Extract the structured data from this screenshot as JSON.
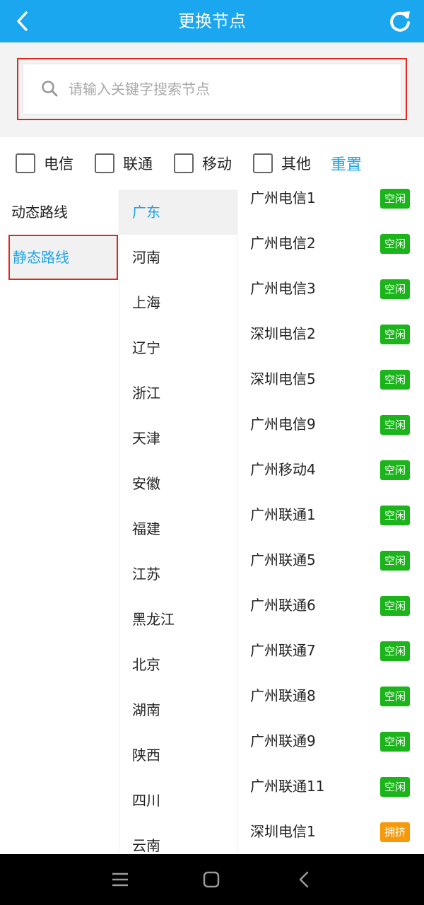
{
  "header": {
    "title": "更换节点",
    "back_icon": "chevron-left-icon",
    "refresh_icon": "refresh-icon"
  },
  "search": {
    "placeholder": "请输入关键字搜索节点",
    "value": "",
    "icon": "search-icon"
  },
  "filters": {
    "options": [
      {
        "label": "电信",
        "checked": false
      },
      {
        "label": "联通",
        "checked": false
      },
      {
        "label": "移动",
        "checked": false
      },
      {
        "label": "其他",
        "checked": false
      }
    ],
    "reset_label": "重置"
  },
  "routes": [
    {
      "label": "动态路线",
      "selected": false
    },
    {
      "label": "静态路线",
      "selected": true
    }
  ],
  "provinces": [
    {
      "label": "广东",
      "selected": true
    },
    {
      "label": "河南"
    },
    {
      "label": "上海"
    },
    {
      "label": "辽宁"
    },
    {
      "label": "浙江"
    },
    {
      "label": "天津"
    },
    {
      "label": "安徽"
    },
    {
      "label": "福建"
    },
    {
      "label": "江苏"
    },
    {
      "label": "黑龙江"
    },
    {
      "label": "北京"
    },
    {
      "label": "湖南"
    },
    {
      "label": "陕西"
    },
    {
      "label": "四川"
    },
    {
      "label": "云南"
    }
  ],
  "nodes": [
    {
      "name": "广州电信1",
      "status": "空闲",
      "status_color": "#1bb51b"
    },
    {
      "name": "广州电信2",
      "status": "空闲",
      "status_color": "#1bb51b"
    },
    {
      "name": "广州电信3",
      "status": "空闲",
      "status_color": "#1bb51b"
    },
    {
      "name": "深圳电信2",
      "status": "空闲",
      "status_color": "#1bb51b"
    },
    {
      "name": "深圳电信5",
      "status": "空闲",
      "status_color": "#1bb51b"
    },
    {
      "name": "广州电信9",
      "status": "空闲",
      "status_color": "#1bb51b"
    },
    {
      "name": "广州移动4",
      "status": "空闲",
      "status_color": "#1bb51b"
    },
    {
      "name": "广州联通1",
      "status": "空闲",
      "status_color": "#1bb51b"
    },
    {
      "name": "广州联通5",
      "status": "空闲",
      "status_color": "#1bb51b"
    },
    {
      "name": "广州联通6",
      "status": "空闲",
      "status_color": "#1bb51b"
    },
    {
      "name": "广州联通7",
      "status": "空闲",
      "status_color": "#1bb51b"
    },
    {
      "name": "广州联通8",
      "status": "空闲",
      "status_color": "#1bb51b"
    },
    {
      "name": "广州联通9",
      "status": "空闲",
      "status_color": "#1bb51b"
    },
    {
      "name": "广州联通11",
      "status": "空闲",
      "status_color": "#1bb51b"
    },
    {
      "name": "深圳电信1",
      "status": "拥挤",
      "status_color": "#f59a0b"
    }
  ],
  "nav": {
    "menu_icon": "menu-icon",
    "home_icon": "home-square-icon",
    "back_icon": "back-triangle-icon"
  },
  "colors": {
    "header_bg": "#1aa7f0",
    "accent": "#20a4e6",
    "highlight": "#e0261f"
  }
}
